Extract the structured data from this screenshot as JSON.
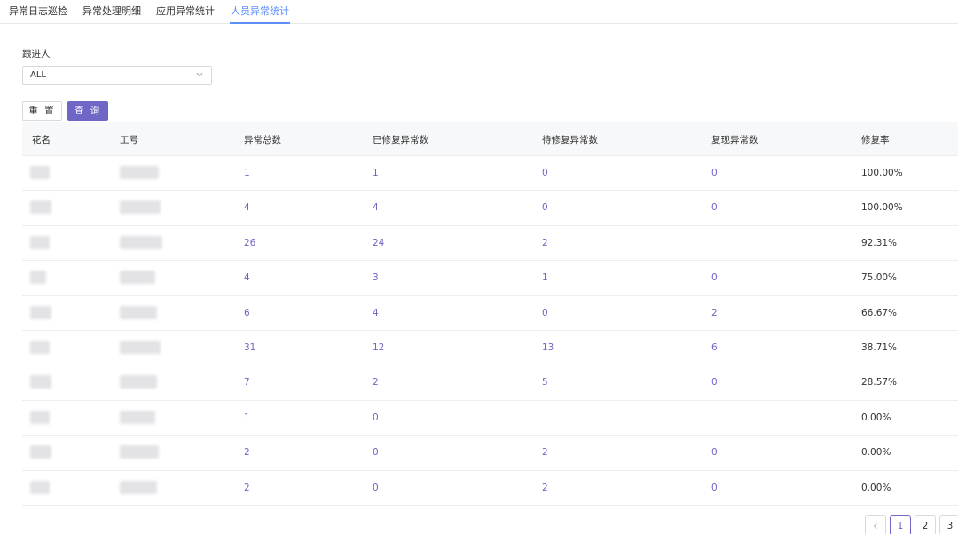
{
  "tabs": [
    {
      "label": "异常日志巡检"
    },
    {
      "label": "异常处理明细"
    },
    {
      "label": "应用异常统计"
    },
    {
      "label": "人员异常统计"
    }
  ],
  "filter": {
    "label": "跟进人",
    "value": "ALL"
  },
  "buttons": {
    "reset": "重 置",
    "query": "查 询"
  },
  "table": {
    "headers": [
      "花名",
      "工号",
      "异常总数",
      "已修复异常数",
      "待修复异常数",
      "复现异常数",
      "修复率"
    ],
    "rows": [
      {
        "total": "1",
        "fixed": "1",
        "pending": "0",
        "reproduced": "0",
        "rate": "100.00%"
      },
      {
        "total": "4",
        "fixed": "4",
        "pending": "0",
        "reproduced": "0",
        "rate": "100.00%"
      },
      {
        "total": "26",
        "fixed": "24",
        "pending": "2",
        "reproduced": "",
        "rate": "92.31%"
      },
      {
        "total": "4",
        "fixed": "3",
        "pending": "1",
        "reproduced": "0",
        "rate": "75.00%"
      },
      {
        "total": "6",
        "fixed": "4",
        "pending": "0",
        "reproduced": "2",
        "rate": "66.67%"
      },
      {
        "total": "31",
        "fixed": "12",
        "pending": "13",
        "reproduced": "6",
        "rate": "38.71%"
      },
      {
        "total": "7",
        "fixed": "2",
        "pending": "5",
        "reproduced": "0",
        "rate": "28.57%"
      },
      {
        "total": "1",
        "fixed": "0",
        "pending": "",
        "reproduced": "",
        "rate": "0.00%"
      },
      {
        "total": "2",
        "fixed": "0",
        "pending": "2",
        "reproduced": "0",
        "rate": "0.00%"
      },
      {
        "total": "2",
        "fixed": "0",
        "pending": "2",
        "reproduced": "0",
        "rate": "0.00%"
      }
    ]
  },
  "pagination": {
    "prev_icon": "chevron-left-icon",
    "pages": [
      "1",
      "2",
      "3"
    ],
    "current": "1"
  },
  "colors": {
    "accent": "#6f66c6",
    "tab_active": "#5b8ff9"
  }
}
